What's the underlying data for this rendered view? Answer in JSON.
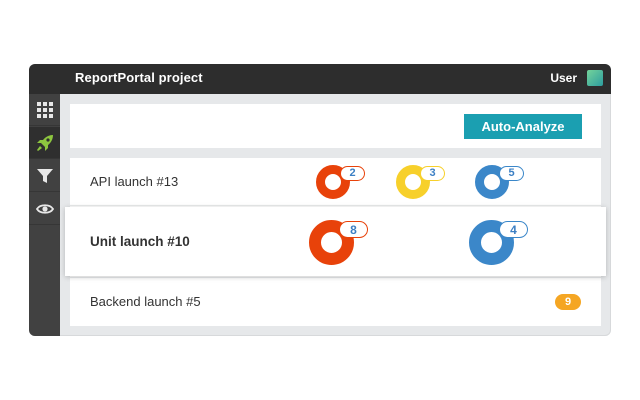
{
  "header": {
    "project_title": "ReportPortal project",
    "user_label": "User",
    "colors": {
      "bar": "#2d2d2d",
      "avatar": "#45b89c"
    }
  },
  "sidebar": {
    "items": [
      {
        "icon": "grid-icon",
        "active": false
      },
      {
        "icon": "rocket-icon",
        "active": true,
        "color": "#8dc63f"
      },
      {
        "icon": "filter-icon",
        "active": false
      },
      {
        "icon": "eye-icon",
        "active": false
      }
    ]
  },
  "toolbar": {
    "auto_analyze_label": "Auto-Analyze",
    "button_color": "#1b9fb1"
  },
  "launches": [
    {
      "name": "API launch #13",
      "indicators": [
        {
          "type": "product-bug",
          "count": "2",
          "color": "#e8420a"
        },
        {
          "type": "automation-bug",
          "count": "3",
          "color": "#f7d02b"
        },
        {
          "type": "system-issue",
          "count": "5",
          "color": "#3b87c9"
        }
      ]
    },
    {
      "name": "Unit launch #10",
      "indicators": [
        {
          "type": "product-bug",
          "count": "8",
          "color": "#e8420a"
        },
        {
          "type": "system-issue",
          "count": "4",
          "color": "#3b87c9"
        }
      ]
    },
    {
      "name": "Backend launch #5",
      "indicators": [
        {
          "type": "to-investigate",
          "count": "9",
          "color": "#f5a623"
        }
      ]
    }
  ]
}
